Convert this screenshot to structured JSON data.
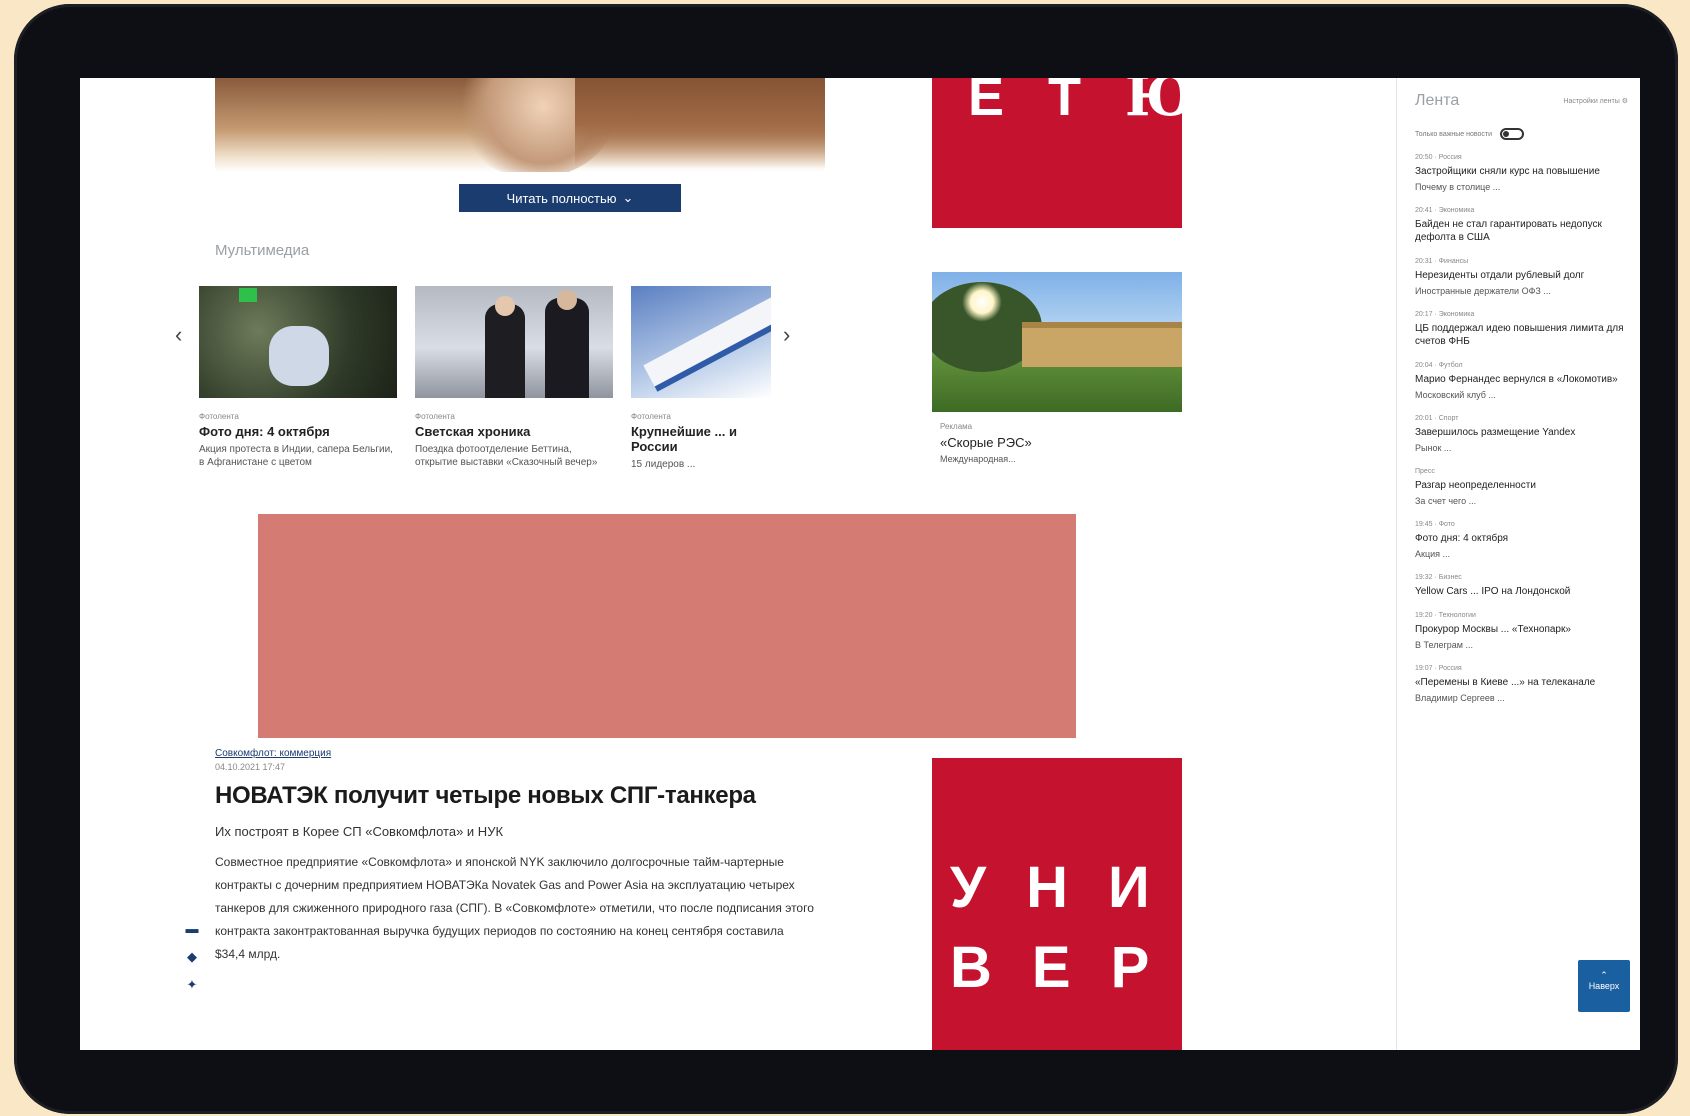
{
  "hero": {
    "button_label": "Читать полностью"
  },
  "multimedia": {
    "title": "Мультимедиа",
    "cards": [
      {
        "kicker": "Фотолента",
        "title": "Фото дня: 4 октября",
        "lead": "Акция протеста в Индии, сапера Бельгии, в Афганистане с цветом"
      },
      {
        "kicker": "Фотолента",
        "title": "Светская хроника",
        "lead": "Поездка фотоотделение Беттина, открытие выставки «Сказочный вечер»"
      },
      {
        "kicker": "Фотолента",
        "title": "Крупнейшие ... и России",
        "lead": "15 лидеров ..."
      }
    ]
  },
  "ad_top": {
    "letters": [
      "Е",
      "Т",
      "Ю"
    ]
  },
  "ad_image": {
    "kicker": "Реклама",
    "title": "«Скорые РЭС»",
    "lead": "Международная..."
  },
  "article": {
    "source": "Совкомфлот: коммерция",
    "date": "04.10.2021 17:47",
    "title": "НОВАТЭК получит четыре новых СПГ-танкера",
    "subtitle": "Их построят в Корее СП «Совкомфлота» и НУК",
    "body": "Совместное предприятие «Совкомфлота» и японской NYK заключило долгосрочные тайм-чартерные контракты с дочерним предприятием НОВАТЭКа Novatek Gas and Power Asia на эксплуатацию четырех танкеров для сжиженного природного газа (СПГ). В «Совкомфлоте» отметили, что после подписания этого контракта законтрактованная выручка будущих периодов по состоянию на конец сентября составила $34,4 млрд."
  },
  "ad_bottom": {
    "letters": [
      "У",
      "Н",
      "И",
      "В",
      "Е",
      "Р"
    ]
  },
  "feed": {
    "title": "Лента",
    "settings": "Настройки ленты",
    "toggle_label": "Только важные новости",
    "items": [
      {
        "meta": "20:50 · Россия",
        "head": "Застройщики сняли курс на повышение",
        "desc": "Почему в столице ...  "
      },
      {
        "meta": "20:41 · Экономика",
        "head": "Байден не стал гарантировать недопуск дефолта в США",
        "desc": ""
      },
      {
        "meta": "20:31 · Финансы",
        "head": "Нерезиденты отдали рублевый долг",
        "desc": "Иностранные держатели ОФЗ ..."
      },
      {
        "meta": "20:17 · Экономика",
        "head": "ЦБ поддержал идею повышения лимита для счетов ФНБ",
        "desc": ""
      },
      {
        "meta": "20:04 · Футбол",
        "head": "Марио Фернандес вернулся в «Локомотив»",
        "desc": "Московский клуб ..."
      },
      {
        "meta": "20:01 · Спорт",
        "head": "Завершилось размещение Yandex",
        "desc": "Рынок ..."
      },
      {
        "meta": "Пресс",
        "head": "Разгар неопределенности",
        "desc": "За счет чего ..."
      },
      {
        "meta": "19:45 · Фото",
        "head": "Фото дня: 4 октября",
        "desc": "Акция ..."
      },
      {
        "meta": "19:32 · Бизнес",
        "head": "Yellow Cars ... IPO на Лондонской",
        "desc": ""
      },
      {
        "meta": "19:20 · Технологии",
        "head": "Прокурор Москвы ... «Технопарк»",
        "desc": "В Телеграм ..."
      },
      {
        "meta": "19:07 · Россия",
        "head": "«Перемены в Киеве ...» на телеканале",
        "desc": "Владимир Сергеев ..."
      }
    ]
  },
  "up_button": {
    "label": "Наверх"
  },
  "colors": {
    "accent": "#1a3c6e",
    "ad_red": "#c4122f",
    "banner": "#d47b73"
  }
}
